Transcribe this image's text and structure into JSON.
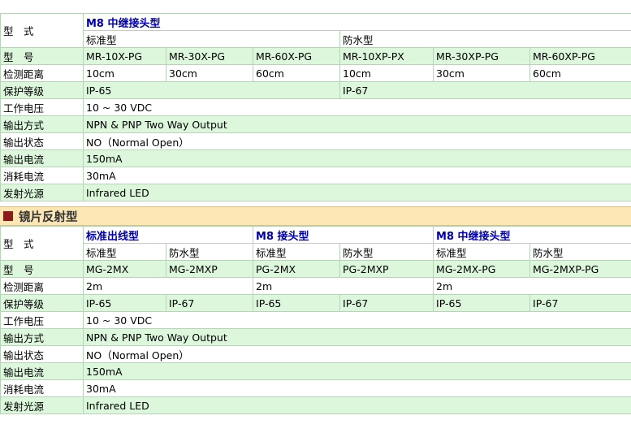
{
  "t1": {
    "header": "M8 中继接头型",
    "group_standard": "标准型",
    "group_waterproof": "防水型",
    "label_type": "型　式",
    "label_model": "型　号",
    "models": [
      "MR-10X-PG",
      "MR-30X-PG",
      "MR-60X-PG",
      "MR-10XP-PX",
      "MR-30XP-PG",
      "MR-60XP-PG"
    ],
    "label_distance": "检测距离",
    "distances": [
      "10cm",
      "30cm",
      "60cm",
      "10cm",
      "30cm",
      "60cm"
    ],
    "label_protection": "保护等级",
    "protection": [
      "IP-65",
      "IP-67"
    ],
    "label_voltage": "工作电压",
    "voltage": "10 ~ 30 VDC",
    "label_output": "输出方式",
    "output": "NPN & PNP Two Way Output",
    "label_state": "输出状态",
    "state": "NO（Normal Open）",
    "label_current": "输出电流",
    "current": "150mA",
    "label_consumption": "消耗电流",
    "consumption": "30mA",
    "label_source": "发射光源",
    "source": "Infrared LED"
  },
  "section2_title": "镜片反射型",
  "t2": {
    "label_type": "型　式",
    "headers": [
      "标准出线型",
      "M8 接头型",
      "M8 中继接头型"
    ],
    "subs": [
      "标准型",
      "防水型",
      "标准型",
      "防水型",
      "标准型",
      "防水型"
    ],
    "label_model": "型　号",
    "models": [
      "MG-2MX",
      "MG-2MXP",
      "PG-2MX",
      "PG-2MXP",
      "MG-2MX-PG",
      "MG-2MXP-PG"
    ],
    "label_distance": "检测距离",
    "distances": [
      "2m",
      "2m",
      "2m"
    ],
    "label_protection": "保护等级",
    "protection": [
      "IP-65",
      "IP-67",
      "IP-65",
      "IP-67",
      "IP-65",
      "IP-67"
    ],
    "label_voltage": "工作电压",
    "voltage": "10 ~ 30 VDC",
    "label_output": "输出方式",
    "output": "NPN & PNP Two Way Output",
    "label_state": "输出状态",
    "state": "NO（Normal Open）",
    "label_current": "输出电流",
    "current": "150mA",
    "label_consumption": "消耗电流",
    "consumption": "30mA",
    "label_source": "发射光源",
    "source": "Infrared LED"
  }
}
